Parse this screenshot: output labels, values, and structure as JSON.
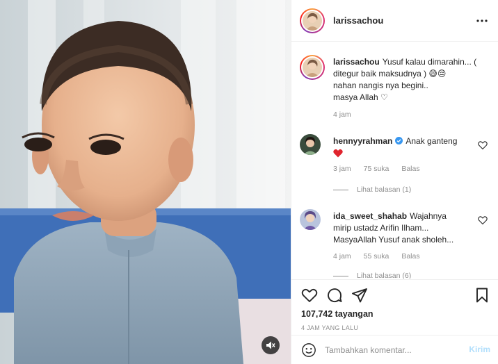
{
  "header": {
    "username": "larissachou",
    "more_icon": "more-horizontal-icon"
  },
  "caption": {
    "username": "larissachou",
    "text_line1": "Yusuf kalau dimarahin... (",
    "text_line2": "ditegur baik maksudnya ) 😅😔",
    "text_line3": "nahan nangis nya begini..",
    "text_line4": "masya Allah ♡",
    "time": "4 jam"
  },
  "comments": [
    {
      "username": "hennyyrahman",
      "verified": true,
      "text": "Anak ganteng",
      "emoji": "❤️",
      "time": "3 jam",
      "likes": "75 suka",
      "reply_label": "Balas",
      "view_replies": "Lihat balasan (1)"
    },
    {
      "username": "ida_sweet_shahab",
      "verified": false,
      "text_line1": "Wajahnya",
      "text_line2": "mirip ustadz Arifin Ilham...",
      "text_line3": "MasyaAllah Yusuf anak sholeh...",
      "time": "4 jam",
      "likes": "55 suka",
      "reply_label": "Balas",
      "view_replies": "Lihat balasan (6)"
    }
  ],
  "stats": {
    "views": "107,742 tayangan",
    "posted_ago": "4 JAM YANG LALU"
  },
  "composer": {
    "placeholder": "Tambahkan komentar...",
    "post_label": "Kirim"
  },
  "colors": {
    "verified_blue": "#3897f0",
    "heart_red": "#ed4956",
    "post_button_disabled": "#b2dffc",
    "meta_gray": "#8e8e8e"
  },
  "icons": {
    "like": "heart-outline-icon",
    "comment": "speech-bubble-icon",
    "share": "paper-plane-icon",
    "save": "bookmark-icon",
    "mute": "speaker-muted-icon",
    "emoji": "smiley-icon"
  }
}
